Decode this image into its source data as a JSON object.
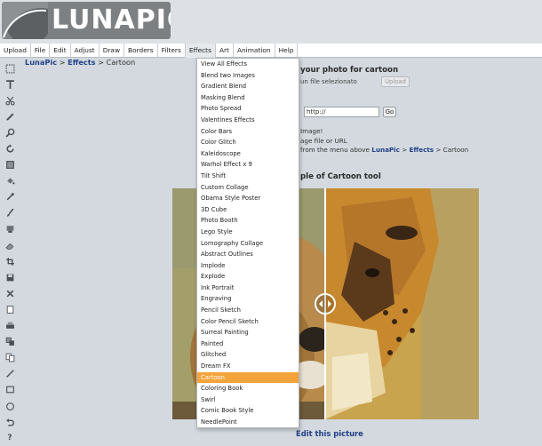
{
  "logo": {
    "text": "LUNAPIC"
  },
  "menu": [
    "Upload",
    "File",
    "Edit",
    "Adjust",
    "Draw",
    "Borders",
    "Filters",
    "Effects",
    "Art",
    "Animation",
    "Help"
  ],
  "breadcrumb": {
    "root": "LunaPic",
    "sep1": " > ",
    "section": "Effects",
    "sep2": " > ",
    "current": "Cartoon"
  },
  "upload": {
    "heading": "your photo for cartoon",
    "file_status": "un file selezionato",
    "upload_button": "Upload",
    "url_value": "http://",
    "go_button": "Go"
  },
  "info": {
    "line1": "Image!",
    "line2": "age file or URL",
    "line3_prefix": "from the menu above ",
    "line3_link1": "LunaPic",
    "line3_sep1": " > ",
    "line3_link2": "Effects",
    "line3_suffix": " > Cartoon"
  },
  "example_heading": "ple of Cartoon tool",
  "edit_link": "Edit this picture",
  "effects_menu": {
    "items": [
      "View All Effects",
      "Blend two Images",
      "Gradient Blend",
      "Masking Blend",
      "Photo Spread",
      "Valentines Effects",
      "Color Bars",
      "Color Glitch",
      "Kaleidoscope",
      "Warhol Effect x 9",
      "Tilt Shift",
      "Custom Collage",
      "Obama Style Poster",
      "3D Cube",
      "Photo Booth",
      "Lego Style",
      "Lomography Collage",
      "Abstract Outlines",
      "Implode",
      "Explode",
      "Ink Portrait",
      "Engraving",
      "Pencil Sketch",
      "Color Pencil Sketch",
      "Surreal Painting",
      "Painted",
      "Glitched",
      "Dream FX",
      "Cartoon",
      "Coloring Book",
      "Swirl",
      "Comic Book Style",
      "NeedlePoint"
    ],
    "selected": "Cartoon"
  },
  "toolbar_icons": [
    "marquee-select-icon",
    "text-tool-icon",
    "scissors-icon",
    "pencil-icon",
    "zoom-icon",
    "rotate-icon",
    "canvas-icon",
    "paint-bucket-icon",
    "eyedropper-icon",
    "brush-icon",
    "clone-stamp-icon",
    "eraser-icon",
    "crop-icon",
    "save-icon",
    "close-icon",
    "new-layer-icon",
    "print-icon",
    "layers-icon",
    "duplicate-icon",
    "line-tool-icon",
    "rectangle-tool-icon",
    "circle-tool-icon",
    "undo-icon",
    "help-icon"
  ],
  "colors": {
    "accent": "#f4a43a",
    "link": "#1f3f86",
    "page_bg": "#d3d9df"
  }
}
